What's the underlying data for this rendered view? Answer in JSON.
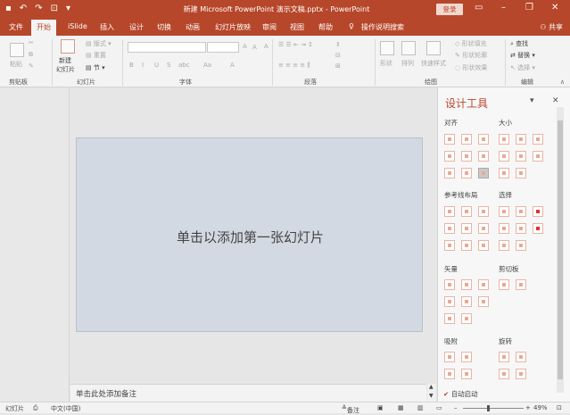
{
  "titlebar": {
    "title": "新建 Microsoft PowerPoint 演示文稿.pptx  -  PowerPoint",
    "login_label": "登录",
    "save_icon": "save-icon",
    "undo_icon": "undo-icon",
    "redo_icon": "redo-icon",
    "start_icon": "start-from-beginning-icon",
    "controls": [
      "ribbon-display-icon",
      "minimize-icon",
      "restore-icon",
      "close-icon"
    ]
  },
  "tabs": [
    "文件",
    "开始",
    "iSlide",
    "插入",
    "设计",
    "切换",
    "动画",
    "幻灯片放映",
    "审阅",
    "视图",
    "帮助"
  ],
  "active_tab": "开始",
  "tell_me": "操作说明搜索",
  "share_label": "共享",
  "ribbon": {
    "clipboard": {
      "paste": "粘贴",
      "label": "剪贴板"
    },
    "slides": {
      "new_slide_line1": "新建",
      "new_slide_line2": "幻灯片",
      "layout": "版式",
      "reset": "重置",
      "section": "节",
      "label": "幻灯片"
    },
    "font": {
      "bold": "B",
      "italic": "I",
      "underline": "U",
      "strike": "S",
      "spacing": "abc",
      "case": "Aa",
      "color": "A",
      "grow": "A",
      "shrink": "A",
      "clear": "A",
      "label": "字体"
    },
    "paragraph": {
      "label": "段落"
    },
    "drawing": {
      "shapes": "形状",
      "arrange": "排列",
      "quick_styles": "快速样式",
      "fill": "形状填充",
      "outline": "形状轮廓",
      "effects": "形状效果",
      "label": "绘图"
    },
    "editing": {
      "find": "查找",
      "replace": "替换",
      "select": "选择",
      "label": "编辑"
    }
  },
  "slide": {
    "placeholder": "单击以添加第一张幻灯片"
  },
  "notes": {
    "placeholder": "单击此处添加备注"
  },
  "pane": {
    "title": "设计工具",
    "sections": {
      "align": "对齐",
      "size": "大小",
      "guides": "参考线布局",
      "select": "选择",
      "vector": "矢量",
      "clip": "剪切板",
      "snap": "吸附",
      "rotate": "旋转"
    },
    "auto_start": "自动启动",
    "auto_start_checked": true
  },
  "status": {
    "slide": "幻灯片",
    "language": "中文(中国)",
    "notes_btn": "备注",
    "zoom": "49%"
  },
  "colors": {
    "accent": "#b7472a",
    "slide_bg": "#d3d9e2"
  }
}
